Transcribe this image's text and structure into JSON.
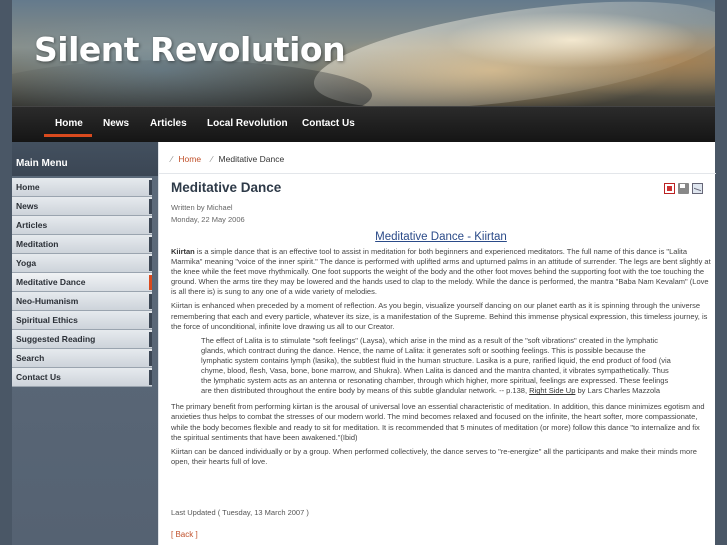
{
  "site": {
    "title": "Silent Revolution"
  },
  "nav": {
    "items": [
      "Home",
      "News",
      "Articles",
      "Local Revolution",
      "Contact Us"
    ],
    "active": "Home",
    "accent_color": "#d94a1e"
  },
  "sidebar": {
    "title": "Main Menu",
    "items": [
      {
        "label": "Home"
      },
      {
        "label": "News"
      },
      {
        "label": "Articles"
      },
      {
        "label": "Meditation"
      },
      {
        "label": "Yoga"
      },
      {
        "label": "Meditative Dance",
        "active": true
      },
      {
        "label": "Neo-Humanism"
      },
      {
        "label": "Spiritual Ethics"
      },
      {
        "label": "Suggested Reading"
      },
      {
        "label": "Search"
      },
      {
        "label": "Contact Us"
      }
    ]
  },
  "breadcrumb": {
    "home": "Home",
    "current": "Meditative Dance"
  },
  "article": {
    "title": "Meditative Dance",
    "author": "Written by Michael",
    "date": "Monday, 22 May 2006",
    "icons": [
      "pdf-icon",
      "print-icon",
      "email-icon"
    ],
    "heading": "Meditative Dance - Kiirtan",
    "p1_bold": "Kiirtan",
    "p1": " is a simple dance that is an effective tool to assist in meditation for both beginners and experienced meditators. The full name of this dance is \"Lalita Marmika\" meaning \"voice of the inner spirit.\" The dance is performed with uplifted arms and upturned palms in an attitude of surrender. The legs are bent slightly at the knee while the feet move rhythmically. One foot supports the weight of the body and the other foot moves behind the supporting foot with the toe touching the ground. When the arms tire they may be lowered and the hands used to clap to the melody. While the dance is performed, the mantra \"Baba Nam Kevalam\" (Love is all there is) is sung to any one of a wide variety of melodies.",
    "p2": "Kiirtan is enhanced when preceded by a moment of reflection. As you begin, visualize yourself dancing on our planet earth as it is spinning through the universe remembering that each and every particle, whatever its size, is a manifestation of the Supreme. Behind this immense physical expression, this timeless journey, is the force of unconditional, infinite love drawing us all to our Creator.",
    "quote": "The effect of Lalita is to stimulate \"soft feelings\" (Laysa), which arise in the mind as a result of the \"soft vibrations\" created in the lymphatic glands, which contract during the dance. Hence, the name of Lalita: it generates soft or soothing feelings. This is possible because the lymphatic system contains lymph (lasika), the subtlest fluid in the human structure. Lasika is a pure, rarified liquid, the end product of food (via chyme, blood, flesh, Vasa, bone, bone marrow, and Shukra). When Lalita is danced and the mantra chanted, it vibrates sympathetically. Thus the lymphatic system acts as an antenna or resonating chamber, through which higher, more spiritual, feelings are expressed. These feelings are then distributed throughout the entire body by means of this subtle glandular network. -- p.138, ",
    "quote_link": "Right Side Up",
    "quote_tail": " by Lars Charles Mazzola",
    "p3": "The primary benefit from performing kiirtan is the arousal of universal love an essential characteristic of meditation. In addition, this dance minimizes egotism and anxieties thus helps to combat the stresses of our modern world. The mind becomes relaxed and focused on the infinite, the heart softer, more compassionate, while the body becomes flexible and ready to sit for meditation. It is recommended that 5 minutes of meditation (or more) follow this dance \"to internalize and fix the spiritual sentiments that have been awakened.\"(Ibid)",
    "p4": "Kiirtan can be danced individually or by a group. When performed collectively, the dance serves to \"re-energize\" all the participants and make their minds more open, their hearts full of love.",
    "last_updated": "Last Updated ( Tuesday, 13 March 2007 )",
    "back": "[ Back ]"
  }
}
